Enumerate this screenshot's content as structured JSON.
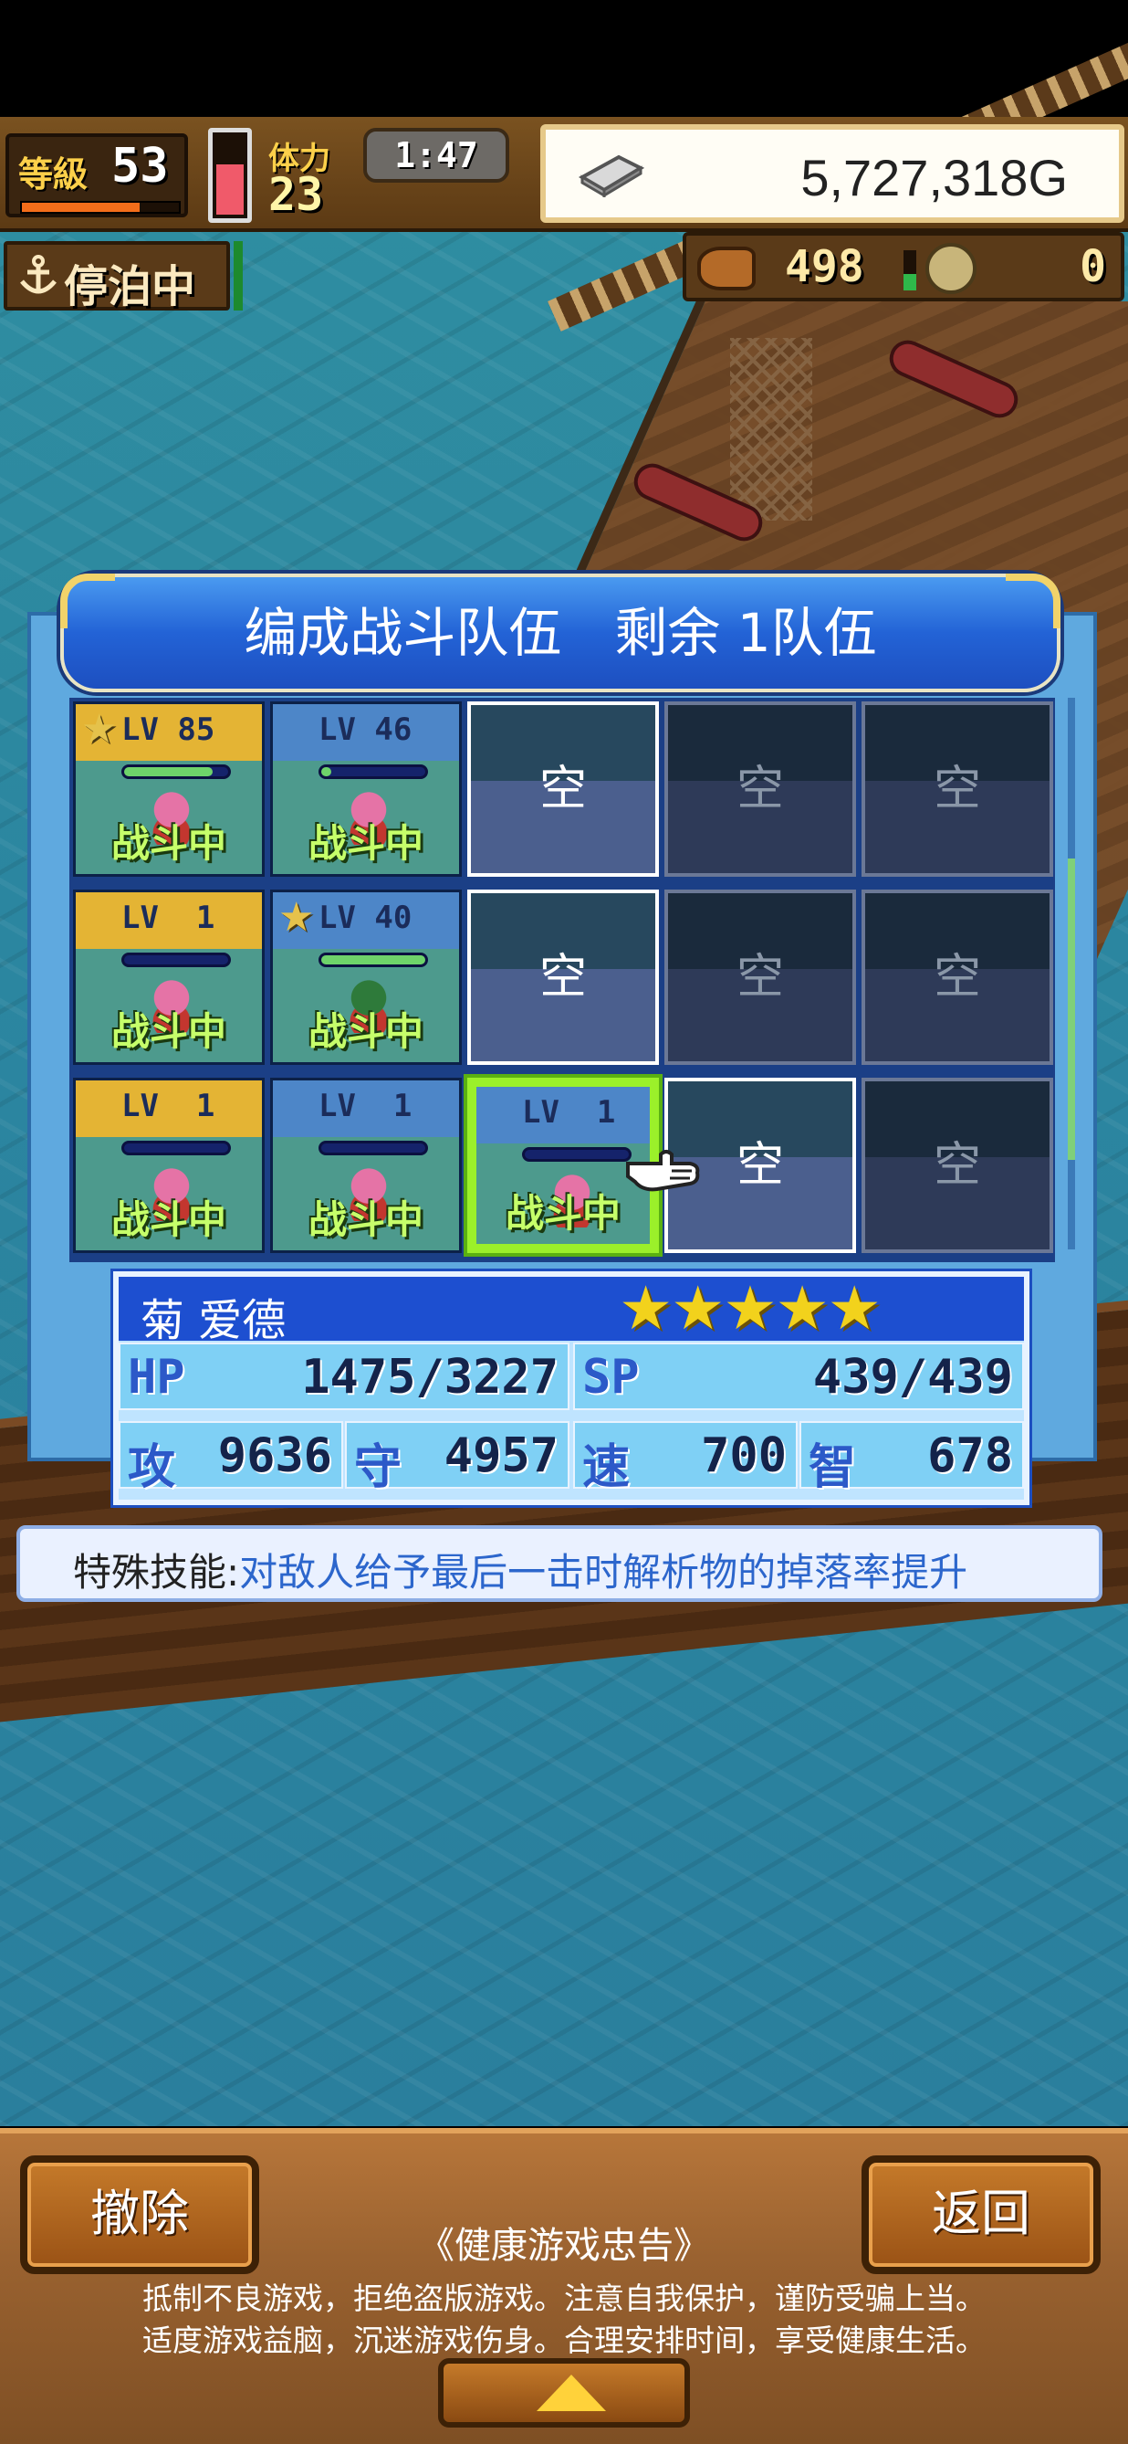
{
  "hud": {
    "level_label": "等級",
    "level": "53",
    "stamina_label": "体力",
    "stamina": "23",
    "clock": "1:47",
    "money": "5,727,318G",
    "anchor_status": "停泊中",
    "resource_food": "498",
    "resource_coin": "0",
    "level_progress": 0.75,
    "stamina_fraction": 0.6
  },
  "dialog": {
    "title": "编成战斗队伍　剩余 1队伍"
  },
  "slots": [
    {
      "type": "member",
      "lv": "LV 85",
      "star": true,
      "head_color": "gold",
      "hp": 0.85,
      "status": "战斗中"
    },
    {
      "type": "member",
      "lv": "LV 46",
      "star": false,
      "head_color": "blue",
      "hp": 0.1,
      "status": "战斗中"
    },
    {
      "type": "empty",
      "label": "空",
      "locked": false
    },
    {
      "type": "empty",
      "label": "空",
      "locked": true
    },
    {
      "type": "empty",
      "label": "空",
      "locked": true
    },
    {
      "type": "member",
      "lv": "LV  1",
      "star": false,
      "head_color": "gold",
      "hp": 0.0,
      "status": "战斗中"
    },
    {
      "type": "member",
      "lv": "LV 40",
      "star": true,
      "head_color": "blue",
      "hp": 1.0,
      "status": "战斗中"
    },
    {
      "type": "empty",
      "label": "空",
      "locked": false
    },
    {
      "type": "empty",
      "label": "空",
      "locked": true
    },
    {
      "type": "empty",
      "label": "空",
      "locked": true
    },
    {
      "type": "member",
      "lv": "LV  1",
      "star": false,
      "head_color": "gold",
      "hp": 0.0,
      "status": "战斗中"
    },
    {
      "type": "member",
      "lv": "LV  1",
      "star": false,
      "head_color": "blue",
      "hp": 0.0,
      "status": "战斗中"
    },
    {
      "type": "member",
      "lv": "LV  1",
      "star": false,
      "head_color": "blue",
      "hp": 0.0,
      "status": "战斗中",
      "selected": true
    },
    {
      "type": "empty",
      "label": "空",
      "locked": false
    },
    {
      "type": "empty",
      "label": "空",
      "locked": true
    }
  ],
  "detail": {
    "name": "菊 爱德",
    "stars": "★★★★★",
    "hp_label": "HP",
    "hp": "1475/3227",
    "sp_label": "SP",
    "sp": "439/439",
    "atk_label": "攻",
    "atk": "9636",
    "def_label": "守",
    "def": "4957",
    "spd_label": "速",
    "spd": "700",
    "int_label": "智",
    "int": "678"
  },
  "skill": {
    "label": "特殊技能:",
    "text": "对敌人给予最后一击时解析物的掉落率提升"
  },
  "bottom": {
    "remove_label": "撤除",
    "back_label": "返回",
    "notice_title": "《健康游戏忠告》",
    "notice_line1": "抵制不良游戏，拒绝盗版游戏。注意自我保护，谨防受骗上当。",
    "notice_line2": "适度游戏益脑，沉迷游戏伤身。合理安排时间，享受健康生活。"
  },
  "colors": {
    "selected_border": "#9bf02a",
    "status_text": "#c6ff6a",
    "skill_text": "#2c66cc",
    "dialog_header": "#2363d6"
  }
}
